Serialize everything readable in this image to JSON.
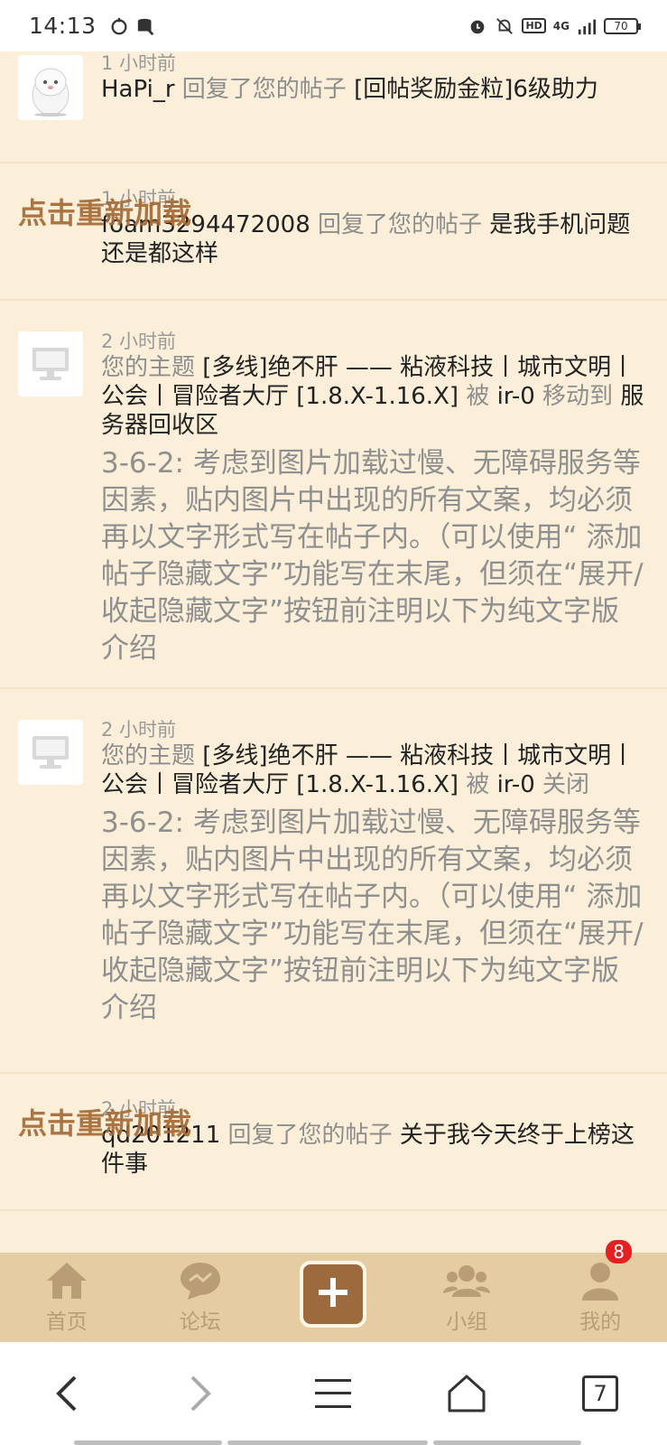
{
  "status_bar": {
    "time": "14:13",
    "battery": "70",
    "hd": "HD",
    "network": "4G"
  },
  "reload_text": "点击重新加载",
  "notifications": [
    {
      "time": "1 小时前",
      "user": "HaPi_r",
      "action": "回复了您的帖子",
      "target": "[回帖奖励金粒]6级助力",
      "avatar": "cartoon-avatar"
    },
    {
      "time": "1 小时前",
      "user": "foam3294472008",
      "action": "回复了您的帖子",
      "target": "是我手机问题还是都这样",
      "avatar": "none",
      "reload_overlay": true
    },
    {
      "time": "2 小时前",
      "prefix": "您的主题",
      "target": "[多线]绝不肝 —— 粘液科技丨城市文明丨公会丨冒险者大厅 [1.8.X-1.16.X]",
      "by": "被",
      "user": "ir-0",
      "action": "移动到",
      "destination": "服务器回收区",
      "reason": "3-6-2: 考虑到图片加载过慢、无障碍服务等因素，贴内图片中出现的所有文案，均必须再以文字形式写在帖子内。（可以使用“ 添加帖子隐藏文字”功能写在末尾，但须在“展开/收起隐藏文字”按钮前注明以下为纯文字版介绍",
      "avatar": "monitor-icon"
    },
    {
      "time": "2 小时前",
      "prefix": "您的主题",
      "target": "[多线]绝不肝 —— 粘液科技丨城市文明丨公会丨冒险者大厅 [1.8.X-1.16.X]",
      "by": "被",
      "user": "ir-0",
      "action": "关闭",
      "reason": "3-6-2: 考虑到图片加载过慢、无障碍服务等因素，贴内图片中出现的所有文案，均必须再以文字形式写在帖子内。（可以使用“ 添加帖子隐藏文字”功能写在末尾，但须在“展开/收起隐藏文字”按钮前注明以下为纯文字版介绍",
      "avatar": "monitor-icon"
    },
    {
      "time": "2 小时前",
      "user": "qd201211",
      "action": "回复了您的帖子",
      "target": "关于我今天终于上榜这件事",
      "avatar": "none",
      "reload_overlay": true
    }
  ],
  "tabbar": {
    "home": "首页",
    "forum": "论坛",
    "groups": "小组",
    "mine": "我的",
    "mine_badge": "8"
  },
  "browser_nav": {
    "tabs_count": "7"
  },
  "colors": {
    "background": "#fbefd9",
    "tabbar": "#e6cca2",
    "accent": "#9d6a3e",
    "reload": "#a56a36",
    "badge": "#e32121"
  }
}
